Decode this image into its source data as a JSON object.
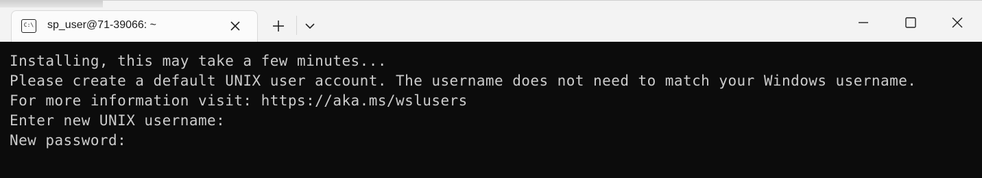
{
  "tab": {
    "title": "sp_user@71-39066: ~",
    "icon": "terminal-icon",
    "icon_glyph": "C:\\"
  },
  "toolbar": {
    "new_tab_icon": "plus-icon",
    "dropdown_icon": "chevron-down-icon"
  },
  "window_controls": {
    "minimize_icon": "minimize-icon",
    "maximize_icon": "maximize-icon",
    "close_icon": "close-icon"
  },
  "terminal": {
    "lines": [
      "Installing, this may take a few minutes...",
      "Please create a default UNIX user account. The username does not need to match your Windows username.",
      "For more information visit: https://aka.ms/wslusers",
      "Enter new UNIX username:",
      "New password:"
    ]
  },
  "colors": {
    "terminal_bg": "#0c0c0c",
    "terminal_fg": "#cccccc",
    "titlebar_bg": "#f3f3f3",
    "tab_bg": "#fbfbfb"
  }
}
